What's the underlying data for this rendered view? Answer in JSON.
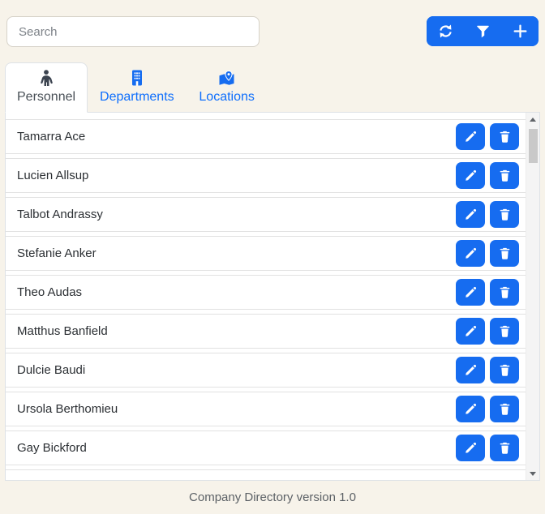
{
  "colors": {
    "page_background": "#f7f3ea",
    "accent_blue": "#166cf0",
    "tab_link_blue": "#0d6efd",
    "panel_border": "#dee2e6"
  },
  "toolbar": {
    "search": {
      "placeholder": "Search",
      "value": ""
    },
    "buttons": [
      {
        "label": "refresh",
        "icon": "refresh-icon"
      },
      {
        "label": "filter",
        "icon": "filter-icon"
      },
      {
        "label": "add",
        "icon": "plus-icon"
      }
    ]
  },
  "tabs": [
    {
      "label": "Personnel",
      "icon": "person-icon",
      "active": true
    },
    {
      "label": "Departments",
      "icon": "building-icon",
      "active": false
    },
    {
      "label": "Locations",
      "icon": "map-location-icon",
      "active": false
    }
  ],
  "personnel": {
    "rows": [
      {
        "name": "Tamarra Ace"
      },
      {
        "name": "Lucien Allsup"
      },
      {
        "name": "Talbot Andrassy"
      },
      {
        "name": "Stefanie Anker"
      },
      {
        "name": "Theo Audas"
      },
      {
        "name": "Matthus Banfield"
      },
      {
        "name": "Dulcie Baudi"
      },
      {
        "name": "Ursola Berthomieu"
      },
      {
        "name": "Gay Bickford"
      }
    ],
    "row_action_icons": {
      "edit": "pencil-icon",
      "delete": "trash-icon"
    }
  },
  "scrollbar": {
    "up_icon": "triangle-up-icon",
    "down_icon": "triangle-down-icon"
  },
  "footer": {
    "text": "Company Directory version 1.0"
  }
}
